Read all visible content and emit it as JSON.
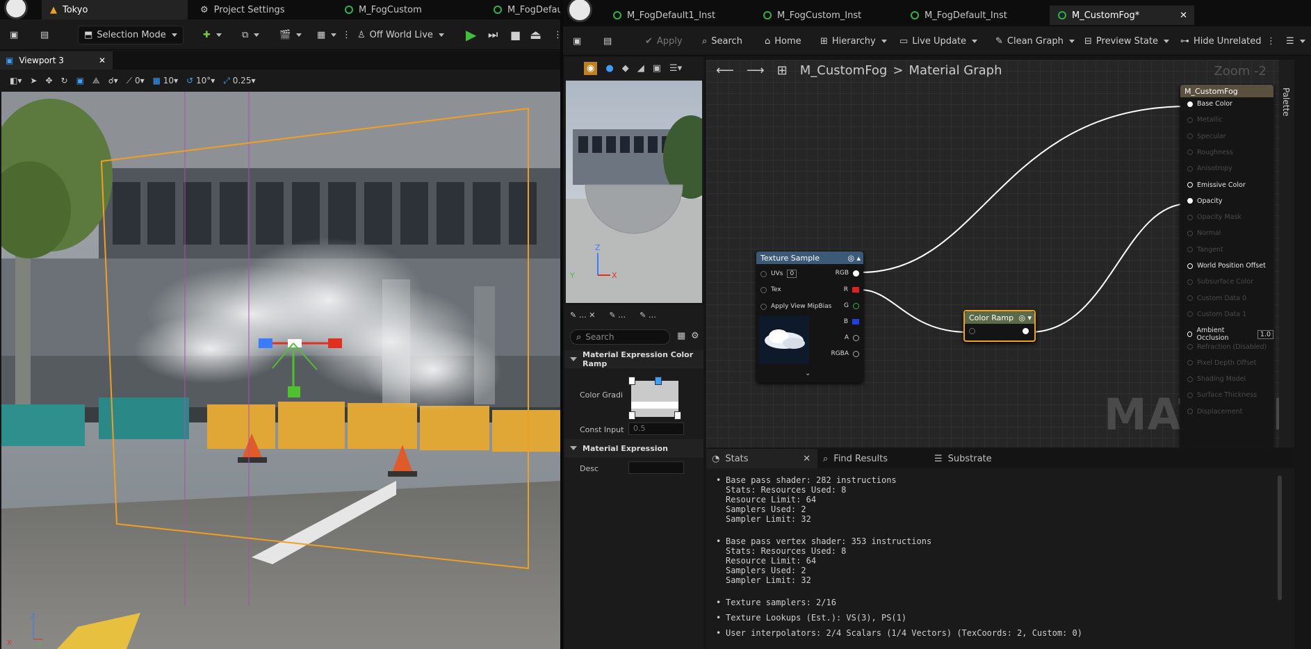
{
  "left_tabs": [
    {
      "label": "Tokyo",
      "active": true
    },
    {
      "label": "Project Settings"
    },
    {
      "label": "M_FogCustom"
    },
    {
      "label": "M_FogDefau"
    }
  ],
  "right_tabs": [
    {
      "label": "M_FogDefault1_Inst"
    },
    {
      "label": "M_FogCustom_Inst"
    },
    {
      "label": "M_FogDefault_Inst"
    },
    {
      "label": "M_CustomFog*",
      "active": true
    }
  ],
  "left_toolbar": {
    "selection_mode": "Selection Mode",
    "world": "Off World Live"
  },
  "viewport": {
    "title": "Viewport 3",
    "rot_snap": "0",
    "grid_snap": "10",
    "angle_snap": "10°",
    "scale_snap": "0.25"
  },
  "mat_toolbar": {
    "apply": "Apply",
    "search": "Search",
    "home": "Home",
    "hierarchy": "Hierarchy",
    "live_update": "Live Update",
    "clean_graph": "Clean Graph",
    "preview_state": "Preview State",
    "hide_unrelated": "Hide Unrelated"
  },
  "graph": {
    "breadcrumb_asset": "M_CustomFog",
    "breadcrumb_sep": ">",
    "breadcrumb_graph": "Material Graph",
    "zoom": "Zoom -2",
    "watermark": "MATERIAL",
    "palette": "Palette"
  },
  "texture_node": {
    "title": "Texture Sample",
    "uv_label": "UVs",
    "uv_value": "0",
    "tex": "Tex",
    "mip": "Apply View MipBias",
    "outputs": [
      "RGB",
      "R",
      "G",
      "B",
      "A",
      "RGBA"
    ]
  },
  "color_ramp": {
    "title": "Color Ramp"
  },
  "material_node": {
    "title": "M_CustomFog",
    "rows": [
      {
        "label": "Base Color",
        "enabled": true
      },
      {
        "label": "Metallic",
        "enabled": false
      },
      {
        "label": "Specular",
        "enabled": false
      },
      {
        "label": "Roughness",
        "enabled": false
      },
      {
        "label": "Anisotropy",
        "enabled": false
      },
      {
        "label": "Emissive Color",
        "enabled": true
      },
      {
        "label": "Opacity",
        "enabled": true
      },
      {
        "label": "Opacity Mask",
        "enabled": false
      },
      {
        "label": "Normal",
        "enabled": false
      },
      {
        "label": "Tangent",
        "enabled": false
      },
      {
        "label": "World Position Offset",
        "enabled": true
      },
      {
        "label": "Subsurface Color",
        "enabled": false
      },
      {
        "label": "Custom Data 0",
        "enabled": false
      },
      {
        "label": "Custom Data 1",
        "enabled": false
      },
      {
        "label": "Ambient Occlusion",
        "enabled": true,
        "value": "1.0"
      },
      {
        "label": "Refraction (Disabled)",
        "enabled": false
      },
      {
        "label": "Pixel Depth Offset",
        "enabled": false
      },
      {
        "label": "Shading Model",
        "enabled": false
      },
      {
        "label": "Surface Thickness",
        "enabled": false
      },
      {
        "label": "Displacement",
        "enabled": false
      }
    ]
  },
  "details": {
    "search_placeholder": "Search",
    "section1": "Material Expression Color Ramp",
    "color_gradient_label": "Color Gradi",
    "const_input_label": "Const Input",
    "const_input_value": "0.5",
    "section2": "Material Expression",
    "desc_label": "Desc",
    "desc_value": ""
  },
  "bottom_tabs": {
    "stats": "Stats",
    "find": "Find Results",
    "substrate": "Substrate"
  },
  "stats": [
    [
      "Base pass shader: 282 instructions",
      "Stats: Resources Used: 8",
      "Resource Limit: 64",
      "Samplers Used: 2",
      "Sampler Limit: 32"
    ],
    [
      "Base pass vertex shader: 353 instructions",
      "Stats: Resources Used: 8",
      "Resource Limit: 64",
      "Samplers Used: 2",
      "Sampler Limit: 32"
    ],
    [
      "Texture samplers: 2/16"
    ],
    [
      "Texture Lookups (Est.): VS(3), PS(1)"
    ],
    [
      "User interpolators: 2/4 Scalars (1/4 Vectors) (TexCoords: 2, Custom: 0)"
    ]
  ],
  "colors": {
    "accent_orange": "#f0a020",
    "green": "#2fb24a",
    "node_header": "#3c5a78"
  }
}
